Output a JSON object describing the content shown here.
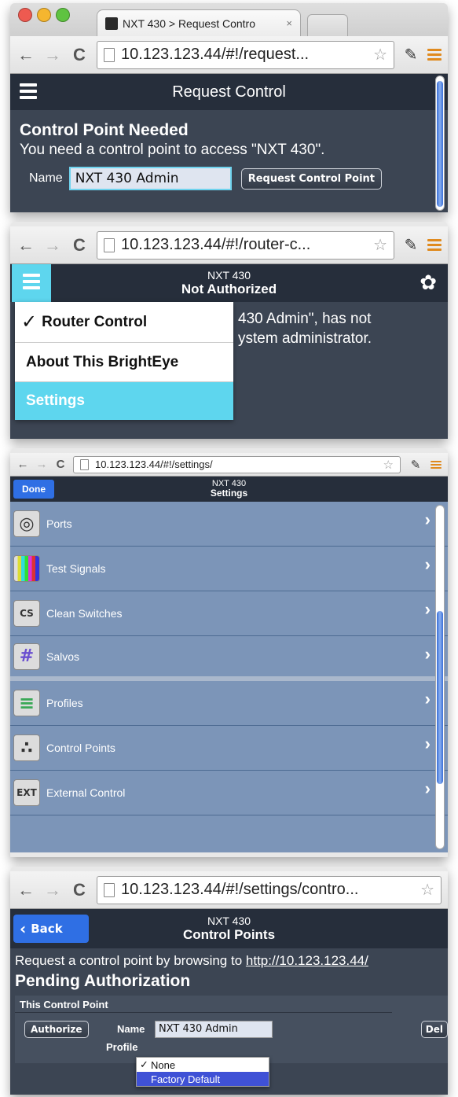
{
  "browser": {
    "tab_title": "NXT 430 > Request Contro",
    "close_glyph": "×",
    "back_glyph": "←",
    "forward_glyph": "→",
    "reload_glyph": "C",
    "star_glyph": "☆",
    "wrench_glyph": "✎",
    "url_1": "10.123.123.44/#!/request...",
    "url_2": "10.123.123.44/#!/router-c...",
    "url_3": "10.123.123.44/#!/settings/",
    "url_4": "10.123.123.44/#!/settings/contro..."
  },
  "panel1": {
    "title": "Request Control",
    "heading": "Control Point Needed",
    "message": "You need a control point to access \"NXT 430\".",
    "name_label": "Name",
    "name_value": "NXT 430 Admin",
    "request_button": "Request Control Point"
  },
  "panel2": {
    "device": "NXT 430",
    "status": "Not Authorized",
    "gear_glyph": "✿",
    "body_line1": "430 Admin\", has not",
    "body_line2": "ystem administrator.",
    "menu": [
      {
        "label": "Router Control",
        "check": "✓",
        "selected": false
      },
      {
        "label": "About This BrightEye",
        "check": "",
        "selected": false
      },
      {
        "label": "Settings",
        "check": "",
        "selected": true
      }
    ]
  },
  "panel3": {
    "device": "NXT 430",
    "page": "Settings",
    "done_button": "Done",
    "items": [
      {
        "label": "Ports",
        "icon": "ports-icon",
        "glyph": "◎"
      },
      {
        "label": "Test Signals",
        "icon": "test-signals-icon",
        "glyph": ""
      },
      {
        "label": "Clean Switches",
        "icon": "clean-switches-icon",
        "glyph": "CS"
      },
      {
        "label": "Salvos",
        "icon": "salvos-icon",
        "glyph": "#"
      },
      {
        "label": "Profiles",
        "icon": "profiles-icon",
        "glyph": "≡"
      },
      {
        "label": "Control Points",
        "icon": "control-points-icon",
        "glyph": "∴"
      },
      {
        "label": "External Control",
        "icon": "external-control-icon",
        "glyph": "EXT"
      }
    ],
    "chevron": "›"
  },
  "panel4": {
    "device": "NXT 430",
    "page": "Control Points",
    "back_button": "Back",
    "request_text": "Request a control point by browsing to ",
    "request_link": "http://10.123.123.44/",
    "heading": "Pending Authorization",
    "section_label": "This Control Point",
    "authorize_button": "Authorize",
    "name_label": "Name",
    "name_value": "NXT 430 Admin",
    "profile_label": "Profile",
    "delete_button": "Del",
    "profile_options": [
      {
        "label": "None",
        "check": "✓"
      },
      {
        "label": "Factory Default",
        "check": ""
      }
    ]
  },
  "colors": {
    "app_bg": "#3c4553",
    "app_bar": "#262e3b",
    "accent_cyan": "#5ed6ee",
    "settings_row": "#7c95b8",
    "done_blue": "#2f6fe4",
    "select_blue": "#3f51d6"
  }
}
